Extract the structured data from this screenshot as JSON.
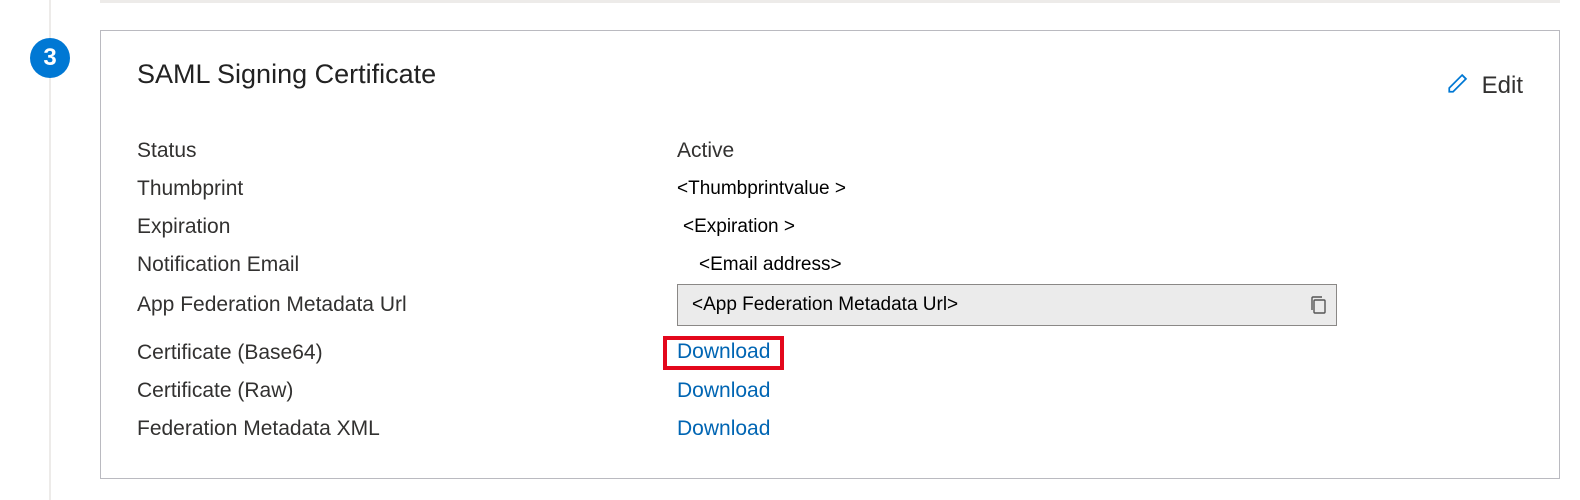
{
  "step_number": "3",
  "card": {
    "title": "SAML Signing Certificate",
    "edit_label": "Edit"
  },
  "fields": {
    "status_label": "Status",
    "status_value": "Active",
    "thumbprint_label": "Thumbprint",
    "thumbprint_value": "<Thumbprintvalue >",
    "expiration_label": "Expiration",
    "expiration_value": "<Expiration >",
    "notification_email_label": "Notification Email",
    "notification_email_value": "<Email address>",
    "metadata_url_label": "App Federation Metadata Url",
    "metadata_url_value": "<App Federation  Metadata Url>",
    "cert_base64_label": "Certificate (Base64)",
    "cert_base64_link": "Download",
    "cert_raw_label": "Certificate (Raw)",
    "cert_raw_link": "Download",
    "fed_xml_label": "Federation Metadata XML",
    "fed_xml_link": "Download"
  }
}
